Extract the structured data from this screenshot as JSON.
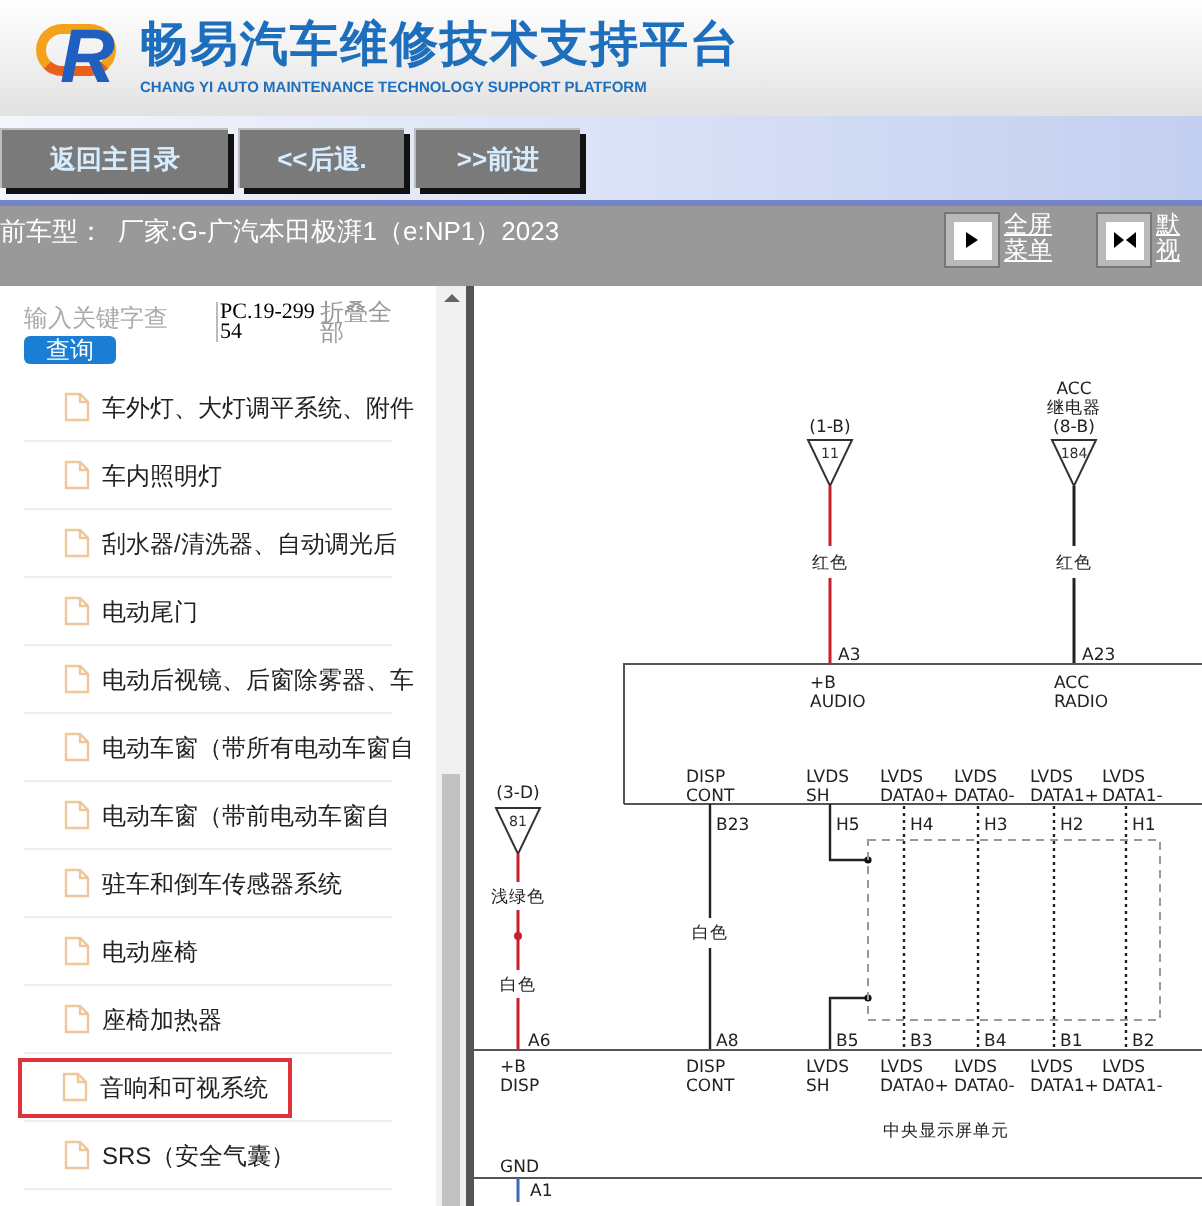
{
  "header": {
    "logo_letter": "R",
    "title": "畅易汽车维修技术支持平台",
    "subtitle": "CHANG YI AUTO MAINTENANCE TECHNOLOGY SUPPORT PLATFORM"
  },
  "nav_buttons": [
    "返回主目录",
    "<<后退.",
    ">>前进"
  ],
  "info_bar": {
    "vehicle": "前车型：  厂家:G-广汽本田极湃1（e:NP1）2023",
    "view_links": [
      {
        "kind": "fullscreen",
        "lines": [
          "全屏",
          "菜单"
        ]
      },
      {
        "kind": "default",
        "lines": [
          "默",
          "视"
        ]
      }
    ]
  },
  "sidebar": {
    "search": {
      "placeholder": "输入关键字查"
    },
    "search_button": "查询",
    "code": "PC.19-29954",
    "collapse_link": "折叠全部",
    "items": [
      {
        "label": "车外灯、大灯调平系统、附件",
        "selected": false
      },
      {
        "label": "车内照明灯",
        "selected": false
      },
      {
        "label": "刮水器/清洗器、自动调光后",
        "selected": false
      },
      {
        "label": "电动尾门",
        "selected": false
      },
      {
        "label": "电动后视镜、后窗除雾器、车",
        "selected": false
      },
      {
        "label": "电动车窗（带所有电动车窗自",
        "selected": false
      },
      {
        "label": "电动车窗（带前电动车窗自",
        "selected": false
      },
      {
        "label": "驻车和倒车传感器系统",
        "selected": false
      },
      {
        "label": "电动座椅",
        "selected": false
      },
      {
        "label": "座椅加热器",
        "selected": false
      },
      {
        "label": "音响和可视系统",
        "selected": true
      },
      {
        "label": "SRS（安全气囊）",
        "selected": false
      }
    ]
  },
  "wiring_diagram": {
    "top_inputs": [
      {
        "label_lines": [
          "(1-B)"
        ],
        "number": "11",
        "wire_label": "红色",
        "pin": "A3",
        "terminal_lines": [
          "+B",
          "AUDIO"
        ],
        "color": "#c8202c"
      },
      {
        "label_lines": [
          "ACC",
          "继电器",
          "(8-B)"
        ],
        "number": "184",
        "wire_label": "红色",
        "pin": "A23",
        "terminal_lines": [
          "ACC",
          "RADIO"
        ],
        "color": "#222222"
      }
    ],
    "side_input": {
      "label_lines": [
        "(3-D)"
      ],
      "number": "81",
      "wire_labels": [
        "浅绿色",
        "白色"
      ],
      "pin": "A6",
      "terminal_lines": [
        "+B",
        "DISP"
      ],
      "color": "#c8202c"
    },
    "connections": [
      {
        "kind": "wire",
        "top_lines": [
          "DISP",
          "CONT"
        ],
        "top_pin": "B23",
        "wire_label": "白色",
        "bottom_pin": "A8",
        "bottom_lines": [
          "DISP",
          "CONT"
        ]
      },
      {
        "kind": "shield",
        "top_lines": [
          "LVDS",
          "SH"
        ],
        "top_pin": "H5",
        "bottom_pin": "B5",
        "bottom_lines": [
          "LVDS",
          "SH"
        ]
      },
      {
        "kind": "twisted",
        "top_lines": [
          "LVDS",
          "DATA0+"
        ],
        "top_pin": "H4",
        "bottom_pin": "B3",
        "bottom_lines": [
          "LVDS",
          "DATA0+"
        ]
      },
      {
        "kind": "twisted",
        "top_lines": [
          "LVDS",
          "DATA0-"
        ],
        "top_pin": "H3",
        "bottom_pin": "B4",
        "bottom_lines": [
          "LVDS",
          "DATA0-"
        ]
      },
      {
        "kind": "twisted",
        "top_lines": [
          "LVDS",
          "DATA1+"
        ],
        "top_pin": "H2",
        "bottom_pin": "B1",
        "bottom_lines": [
          "LVDS",
          "DATA1+"
        ]
      },
      {
        "kind": "twisted",
        "top_lines": [
          "LVDS",
          "DATA1-"
        ],
        "top_pin": "H1",
        "bottom_pin": "B2",
        "bottom_lines": [
          "LVDS",
          "DATA1-"
        ]
      }
    ],
    "unit_name": "中央显示屏单元",
    "ground": {
      "label": "GND",
      "pin": "A1",
      "color": "#3a6fb0"
    }
  }
}
